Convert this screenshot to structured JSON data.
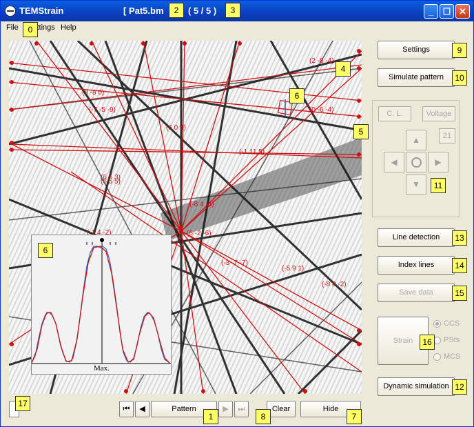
{
  "window": {
    "title": "TEMStrain",
    "file_label": "[ Pat5.bm",
    "count_label": "( 5 / 5 )",
    "controls": [
      "minimize",
      "maximize",
      "close"
    ]
  },
  "menu": [
    "File",
    "Settings",
    "Help"
  ],
  "pattern_labels": [
    "(2 -8 -4)",
    "(8 -8 0)",
    "(-7 -5 -9)",
    "(0 -6 -4)",
    "(6 0 4)",
    "(-1 11 5)",
    "(6 5 3)",
    "(6 5 5)",
    "(-8 4 -4)",
    "(6 -2 -6)",
    "(-3 -7 -7)",
    "(-5 9 1)",
    "(-8 8 -2)",
    "(-1 4 -2)"
  ],
  "inset": {
    "max_label": "Max."
  },
  "right_panel": {
    "settings": "Settings",
    "simulate": "Simulate pattern",
    "cl": "C. L.",
    "voltage": "Voltage",
    "zoom_value": "21",
    "line_detection": "Line detection",
    "index_lines": "Index lines",
    "save_data": "Save data",
    "strain": "Strain",
    "radio_options": [
      "CCS",
      "PSts",
      "MCS"
    ],
    "radio_selected": "CCS",
    "dynamic_simulation": "Dynamic simulation"
  },
  "bottom_bar": {
    "pattern": "Pattern",
    "clear": "Clear",
    "hide": "Hide"
  },
  "annotations": [
    "0",
    "1",
    "2",
    "3",
    "4",
    "5",
    "6",
    "6",
    "7",
    "8",
    "9",
    "10",
    "11",
    "12",
    "13",
    "14",
    "15",
    "16",
    "17"
  ],
  "colors": {
    "title_bar": "#0a4fd4",
    "line_red": "#cc1111",
    "badge": "#ffff66"
  }
}
